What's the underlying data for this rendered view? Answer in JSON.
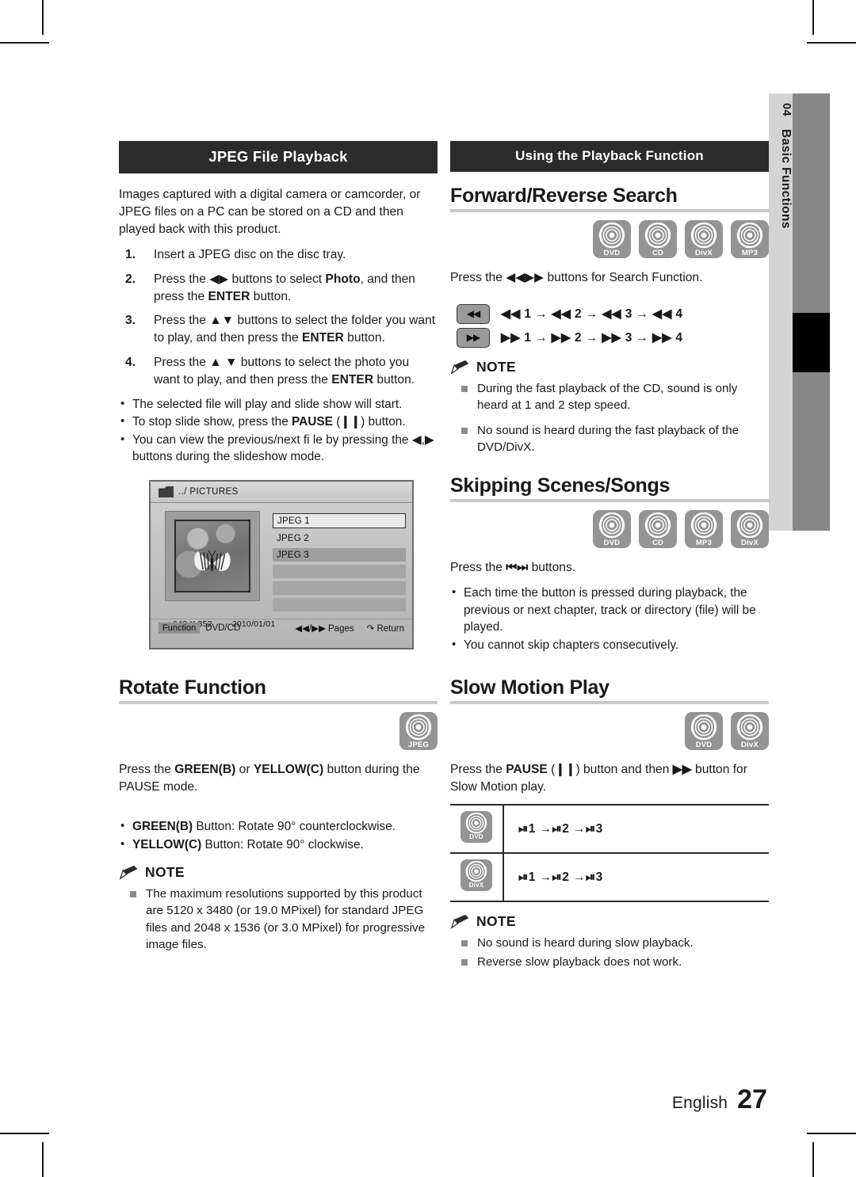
{
  "page": {
    "language": "English",
    "number": "27",
    "side_tab": {
      "chapter_number": "04",
      "chapter_title": "Basic Functions"
    }
  },
  "left_column": {
    "banner": "JPEG File Playback",
    "intro": "Images captured with a digital camera or camcorder, or JPEG files on a PC can be stored on a CD and then played back with this product.",
    "steps": [
      {
        "num": "1.",
        "text": "Insert a JPEG disc on the disc tray."
      },
      {
        "num": "2.",
        "text": "Press the ◀▶ buttons to select Photo, and then press the ENTER button."
      },
      {
        "num": "3.",
        "text": "Press the ▲▼ buttons to select the folder you want to play, and then press the ENTER button."
      },
      {
        "num": "4.",
        "text": "Press the ▲ ▼ buttons to select the photo you want to play, and then press the ENTER button."
      }
    ],
    "step4_bullets": [
      "The selected file will play and slide show will start.",
      "To stop slide show, press the PAUSE (Ⅱ) button.",
      "You can view the previous/next fi le by pressing the ◀,▶ buttons during the slideshow mode."
    ],
    "mockup": {
      "title": "../ PICTURES",
      "files": [
        "JPEG 1",
        "JPEG 2",
        "JPEG 3"
      ],
      "resolution": "642 X 352",
      "date": "2010/01/01",
      "footer_function_label": "Function",
      "footer_source": "DVD/CD",
      "footer_pages": "Pages",
      "footer_return": "Return"
    },
    "rotate": {
      "heading": "Rotate Function",
      "discs": [
        {
          "label": "JPEG"
        }
      ],
      "intro": "Press the GREEN(B) or YELLOW(C) button during the PAUSE mode.",
      "bullets": [
        "GREEN(B) Button: Rotate 90° counterclockwise.",
        "YELLOW(C) Button: Rotate 90° clockwise."
      ],
      "note_label": "NOTE",
      "notes": [
        "The maximum resolutions supported by this product are 5120 x 3480 (or 19.0 MPixel) for standard JPEG files and 2048 x 1536 (or 3.0 MPixel) for progressive image files."
      ]
    }
  },
  "right_column": {
    "banner": "Using the Playback Function",
    "search": {
      "heading": "Forward/Reverse Search",
      "discs": [
        {
          "label": "DVD"
        },
        {
          "label": "CD"
        },
        {
          "label": "DivX"
        },
        {
          "label": "MP3"
        }
      ],
      "intro": "Press the ◀◀▶▶ buttons for Search Function.",
      "key_rows": [
        {
          "key": "◀◀",
          "sequence": "◀◀ 1 → ◀◀ 2 → ◀◀ 3 → ◀◀ 4"
        },
        {
          "key": "▶▶",
          "sequence": "▶▶ 1 → ▶▶ 2 → ▶▶ 3 → ▶▶ 4"
        }
      ],
      "note_label": "NOTE",
      "notes": [
        "During the fast playback of the CD, sound is only heard at 1 and 2 step speed.",
        "No sound is heard during the fast playback of the DVD/DivX."
      ]
    },
    "skipping": {
      "heading": "Skipping Scenes/Songs",
      "discs": [
        {
          "label": "DVD"
        },
        {
          "label": "CD"
        },
        {
          "label": "MP3"
        },
        {
          "label": "DivX"
        }
      ],
      "intro": "Press the ⏮⏭ buttons.",
      "bullets": [
        "Each time the button is pressed during playback, the previous or next chapter, track or directory (file) will be played.",
        "You cannot skip chapters consecutively."
      ]
    },
    "slow_motion": {
      "heading": "Slow Motion Play",
      "discs": [
        {
          "label": "DVD"
        },
        {
          "label": "DivX"
        }
      ],
      "intro": "Press the PAUSE (Ⅱ) button and then ▶▶ button for Slow Motion play.",
      "table": [
        {
          "disc": "DVD",
          "sequence": "⏯1 →⏯2 →⏯3"
        },
        {
          "disc": "DivX",
          "sequence": "⏯1 →⏯2 →⏯3"
        }
      ],
      "note_label": "NOTE",
      "notes": [
        "No sound is heard during slow playback.",
        "Reverse slow playback does not work."
      ]
    }
  }
}
